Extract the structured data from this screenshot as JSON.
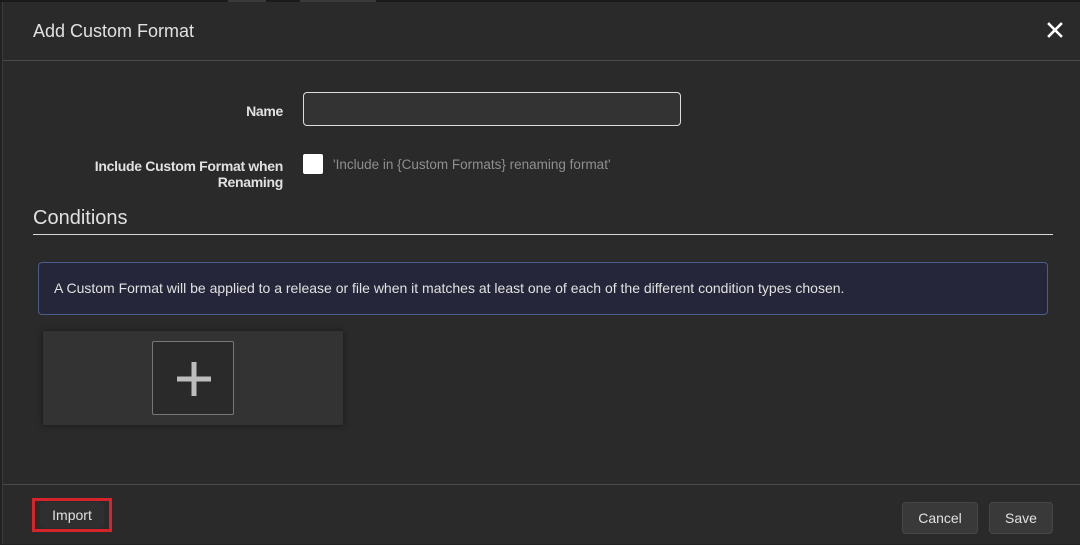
{
  "modal": {
    "title": "Add Custom Format",
    "close_icon": "close-icon"
  },
  "form": {
    "name_label": "Name",
    "name_value": "",
    "name_placeholder": "",
    "include_label": "Include Custom Format when Renaming",
    "include_checked": false,
    "include_help": "'Include in {Custom Formats} renaming format'"
  },
  "conditions": {
    "title": "Conditions",
    "info_text": "A Custom Format will be applied to a release or file when it matches at least one of each of the different condition types chosen.",
    "add_icon": "plus-icon"
  },
  "footer": {
    "import_label": "Import",
    "cancel_label": "Cancel",
    "save_label": "Save",
    "highlight_color": "#d6242a"
  }
}
